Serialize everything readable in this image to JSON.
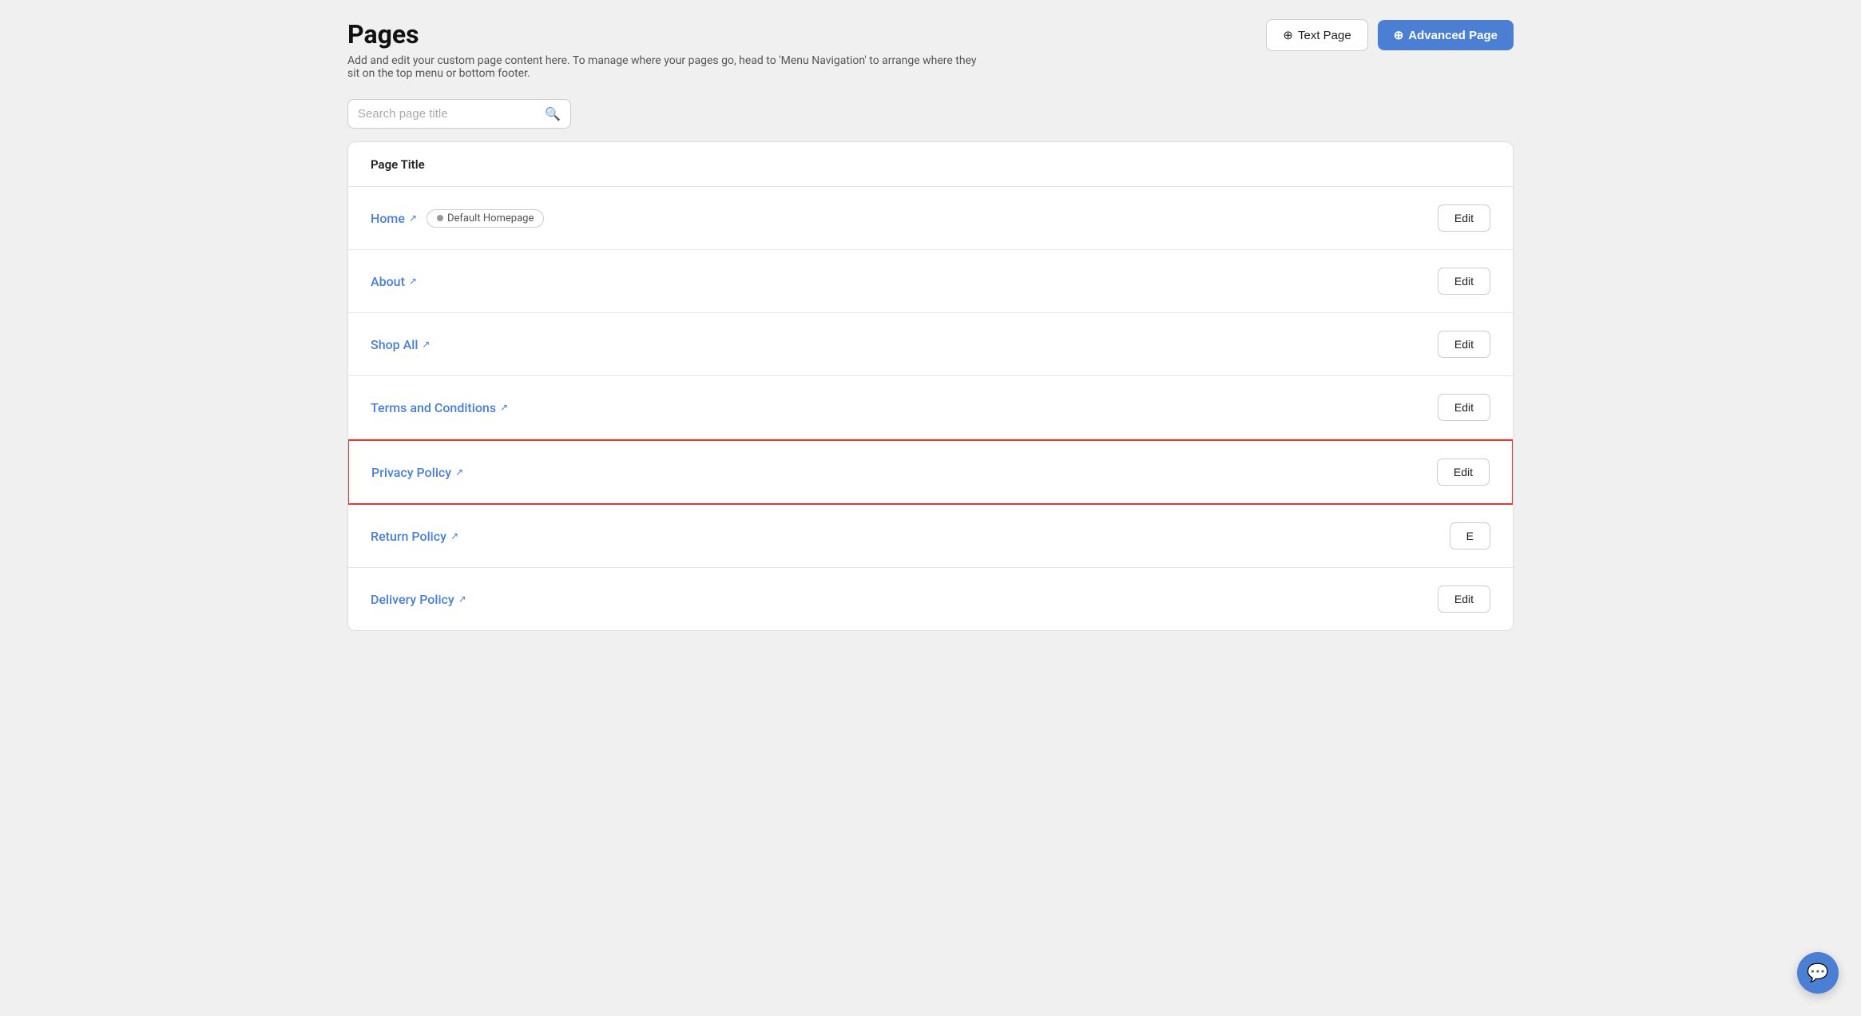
{
  "header": {
    "title": "Pages",
    "description": "Add and edit your custom page content here. To manage where your pages go, head to 'Menu Navigation' to arrange where they sit on the top menu or bottom footer.",
    "text_page_button": "Text Page",
    "advanced_page_button": "Advanced Page"
  },
  "search": {
    "placeholder": "Search page title"
  },
  "table": {
    "column_header": "Page Title",
    "rows": [
      {
        "id": "home",
        "label": "Home",
        "badge": "Default Homepage",
        "has_badge": true,
        "highlighted": false,
        "edit_label": "Edit"
      },
      {
        "id": "about",
        "label": "About",
        "has_badge": false,
        "highlighted": false,
        "edit_label": "Edit"
      },
      {
        "id": "shop-all",
        "label": "Shop All",
        "has_badge": false,
        "highlighted": false,
        "edit_label": "Edit"
      },
      {
        "id": "terms-and-conditions",
        "label": "Terms and Conditions",
        "has_badge": false,
        "highlighted": false,
        "edit_label": "Edit"
      },
      {
        "id": "privacy-policy",
        "label": "Privacy Policy",
        "has_badge": false,
        "highlighted": true,
        "edit_label": "Edit"
      },
      {
        "id": "return-policy",
        "label": "Return Policy",
        "has_badge": false,
        "highlighted": false,
        "edit_label": "E"
      },
      {
        "id": "delivery-policy",
        "label": "Delivery Policy",
        "has_badge": false,
        "highlighted": false,
        "edit_label": "Edit"
      }
    ]
  },
  "chat_widget": {
    "icon": "💬"
  }
}
